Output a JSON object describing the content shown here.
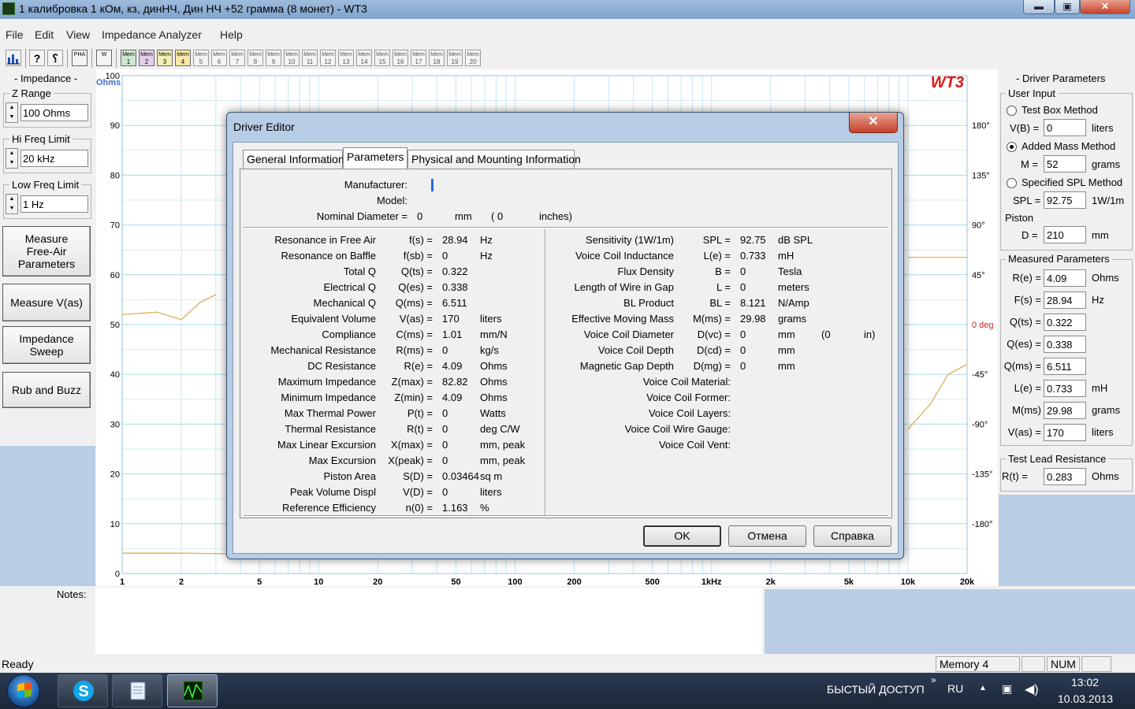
{
  "window": {
    "title": "1 калибровка 1 кОм, кз, динНЧ, Дин НЧ +52 грамма (8 монет) - WT3",
    "minimize": "▬",
    "maximize": "▣",
    "close": "✕"
  },
  "menu": [
    "File",
    "Edit",
    "View",
    "Impedance Analyzer",
    "Help"
  ],
  "toolbar": {
    "pha": "PHA",
    "w": "W",
    "mems": [
      "1",
      "2",
      "3",
      "4",
      "5",
      "6",
      "7",
      "8",
      "9",
      "10",
      "11",
      "12",
      "13",
      "14",
      "15",
      "16",
      "17",
      "18",
      "19",
      "20"
    ],
    "mem_label": "Mem"
  },
  "left_panel": {
    "title": "- Impedance -",
    "z_range": {
      "label": "Z Range",
      "value": "100 Ohms"
    },
    "hi_freq": {
      "label": "Hi Freq Limit",
      "value": "20 kHz"
    },
    "low_freq": {
      "label": "Low Freq Limit",
      "value": "1 Hz"
    },
    "buttons": [
      "Measure Free-Air Parameters",
      "Measure V(as)",
      "Impedance Sweep",
      "Rub and Buzz"
    ],
    "rlc": [
      "R",
      "L",
      "C"
    ]
  },
  "chart_data": {
    "type": "line",
    "logo": "WT3",
    "y_unit": "Ohms",
    "y_ticks": [
      "100",
      "90",
      "80",
      "70",
      "60",
      "50",
      "40",
      "30",
      "20",
      "10",
      "0"
    ],
    "y2_ticks": [
      "180°",
      "135°",
      "90°",
      "45°",
      "0 deg",
      "-45°",
      "-90°",
      "-135°",
      "-180°"
    ],
    "x_ticks": [
      "1",
      "2",
      "5",
      "10",
      "20",
      "50",
      "100",
      "200",
      "500",
      "1kHz",
      "2k",
      "5k",
      "10k",
      "20k"
    ],
    "x_scale": "log",
    "ylim": [
      0,
      100
    ],
    "xlim": [
      1,
      20000
    ],
    "series": [
      {
        "x": [
          1,
          1.5,
          2,
          2.5,
          3
        ],
        "values": [
          52,
          52.5,
          51,
          54.5,
          56
        ],
        "color": "#d8a94a"
      },
      {
        "x": [
          10000,
          15000,
          20000
        ],
        "values": [
          63.5,
          63.5,
          63.5
        ],
        "color": "#d8a94a"
      },
      {
        "x": [
          10000,
          13000,
          16000,
          20000
        ],
        "values": [
          29,
          34,
          40,
          42
        ],
        "color": "#d8a94a"
      },
      {
        "x": [
          1,
          2,
          3,
          4
        ],
        "values": [
          4.1,
          4.1,
          4.0,
          3.9
        ],
        "color": "#d8a94a"
      }
    ]
  },
  "right_panel": {
    "title": "- Driver Parameters",
    "user_input": "User Input",
    "test_box": "Test Box Method",
    "vb_label": "V(B) =",
    "vb_value": "0",
    "vb_unit": "liters",
    "added_mass": "Added Mass Method",
    "m_label": "M =",
    "m_value": "52",
    "m_unit": "grams",
    "spl_method": "Specified SPL Method",
    "spl_label": "SPL =",
    "spl_value": "92.75",
    "spl_unit": "1W/1m",
    "piston": "Piston",
    "d_label": "D =",
    "d_value": "210",
    "d_unit": "mm",
    "measured": "Measured Parameters",
    "measured_rows": [
      {
        "label": "R(e) =",
        "value": "4.09",
        "unit": "Ohms"
      },
      {
        "label": "F(s) =",
        "value": "28.94",
        "unit": "Hz"
      },
      {
        "label": "Q(ts) =",
        "value": "0.322",
        "unit": ""
      },
      {
        "label": "Q(es) =",
        "value": "0.338",
        "unit": ""
      },
      {
        "label": "Q(ms) =",
        "value": "6.511",
        "unit": ""
      },
      {
        "label": "L(e) =",
        "value": "0.733",
        "unit": "mH"
      },
      {
        "label": "M(ms)",
        "value": "29.98",
        "unit": "grams"
      },
      {
        "label": "V(as) =",
        "value": "170",
        "unit": "liters"
      }
    ],
    "test_lead": "Test Lead Resistance",
    "rt_label": "R(t) =",
    "rt_value": "0.283",
    "rt_unit": "Ohms"
  },
  "notes": {
    "label": "Notes:"
  },
  "status": {
    "text": "Ready",
    "memory": "Memory 4",
    "num": "NUM"
  },
  "taskbar": {
    "quick": "БЫСТЫЙ ДОСТУП",
    "chev": "»",
    "lang": "RU",
    "time": "13:02",
    "date": "10.03.2013"
  },
  "dialog": {
    "title": "Driver Editor",
    "close": "✕",
    "tabs": [
      "General Information",
      "Parameters",
      "Physical and Mounting Information"
    ],
    "manufacturer": "Manufacturer:",
    "model": "Model:",
    "nominal": {
      "label": "Nominal Diameter =",
      "value": "0",
      "unit": "mm",
      "paren_open": "( 0",
      "inches": "inches)"
    },
    "left_rows": [
      {
        "name": "Resonance in Free Air",
        "sym": "f(s) =",
        "value": "28.94",
        "unit": "Hz"
      },
      {
        "name": "Resonance on Baffle",
        "sym": "f(sb) =",
        "value": "0",
        "unit": "Hz"
      },
      {
        "name": "Total Q",
        "sym": "Q(ts) =",
        "value": "0.322",
        "unit": ""
      },
      {
        "name": "Electrical Q",
        "sym": "Q(es) =",
        "value": "0.338",
        "unit": ""
      },
      {
        "name": "Mechanical Q",
        "sym": "Q(ms) =",
        "value": "6.511",
        "unit": ""
      },
      {
        "name": "Equivalent Volume",
        "sym": "V(as) =",
        "value": "170",
        "unit": "liters"
      },
      {
        "name": "Compliance",
        "sym": "C(ms) =",
        "value": "1.01",
        "unit": "mm/N"
      },
      {
        "name": "Mechanical Resistance",
        "sym": "R(ms) =",
        "value": "0",
        "unit": "kg/s"
      },
      {
        "name": "DC Resistance",
        "sym": "R(e) =",
        "value": "4.09",
        "unit": "Ohms"
      },
      {
        "name": "Maximum Impedance",
        "sym": "Z(max) =",
        "value": "82.82",
        "unit": "Ohms"
      },
      {
        "name": "Minimum Impedance",
        "sym": "Z(min) =",
        "value": "4.09",
        "unit": "Ohms"
      },
      {
        "name": "Max Thermal Power",
        "sym": "P(t) =",
        "value": "0",
        "unit": "Watts"
      },
      {
        "name": "Thermal Resistance",
        "sym": "R(t) =",
        "value": "0",
        "unit": "deg C/W"
      },
      {
        "name": "Max Linear Excursion",
        "sym": "X(max) =",
        "value": "0",
        "unit": "mm, peak"
      },
      {
        "name": "Max Excursion",
        "sym": "X(peak) =",
        "value": "0",
        "unit": "mm, peak"
      },
      {
        "name": "Piston Area",
        "sym": "S(D) =",
        "value": "0.03464",
        "unit": "sq m"
      },
      {
        "name": "Peak Volume Displ",
        "sym": "V(D) =",
        "value": "0",
        "unit": "liters"
      },
      {
        "name": "Reference Efficiency",
        "sym": "n(0) =",
        "value": "1.163",
        "unit": "%"
      }
    ],
    "right_rows": [
      {
        "name": "Sensitivity (1W/1m)",
        "sym": "SPL =",
        "value": "92.75",
        "unit": "dB SPL"
      },
      {
        "name": "Voice Coil Inductance",
        "sym": "L(e) =",
        "value": "0.733",
        "unit": "mH"
      },
      {
        "name": "Flux Density",
        "sym": "B =",
        "value": "0",
        "unit": "Tesla"
      },
      {
        "name": "Length of Wire in Gap",
        "sym": "L =",
        "value": "0",
        "unit": "meters"
      },
      {
        "name": "BL Product",
        "sym": "BL =",
        "value": "8.121",
        "unit": "N/Amp"
      },
      {
        "name": "Effective Moving Mass",
        "sym": "M(ms) =",
        "value": "29.98",
        "unit": "grams"
      },
      {
        "name": "Voice Coil Diameter",
        "sym": "D(vc) =",
        "value": "0",
        "unit": "mm"
      },
      {
        "name": "Voice Coil Depth",
        "sym": "D(cd) =",
        "value": "0",
        "unit": "mm"
      },
      {
        "name": "Magnetic Gap Depth",
        "sym": "D(mg) =",
        "value": "0",
        "unit": "mm"
      }
    ],
    "vc_in_open": "(0",
    "vc_in_unit": "in)",
    "right_labels": [
      "Voice Coil Material:",
      "Voice Coil Former:",
      "Voice Coil Layers:",
      "Voice Coil Wire Gauge:",
      "Voice Coil Vent:"
    ],
    "buttons": [
      "OK",
      "Отмена",
      "Справка"
    ]
  }
}
